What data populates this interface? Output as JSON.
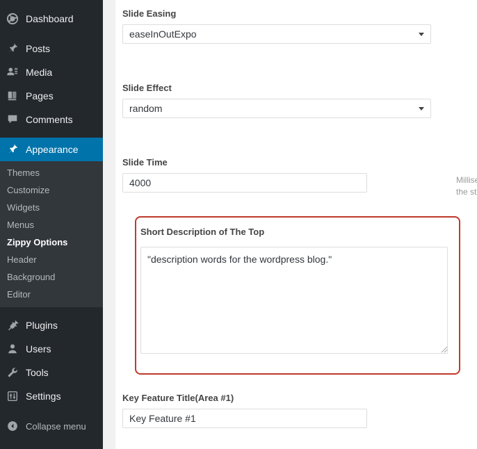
{
  "sidebar": {
    "top_items": [
      {
        "label": "Dashboard",
        "icon": "dashboard-icon",
        "current": false
      },
      {
        "label": "Posts",
        "icon": "pushpin-icon",
        "current": false
      },
      {
        "label": "Media",
        "icon": "media-icon",
        "current": false
      },
      {
        "label": "Pages",
        "icon": "pages-icon",
        "current": false
      },
      {
        "label": "Comments",
        "icon": "comments-icon",
        "current": false
      },
      {
        "label": "Appearance",
        "icon": "appearance-brush-icon",
        "current": true
      }
    ],
    "submenu": [
      {
        "label": "Themes",
        "current": false
      },
      {
        "label": "Customize",
        "current": false
      },
      {
        "label": "Widgets",
        "current": false
      },
      {
        "label": "Menus",
        "current": false
      },
      {
        "label": "Zippy Options",
        "current": true
      },
      {
        "label": "Header",
        "current": false
      },
      {
        "label": "Background",
        "current": false
      },
      {
        "label": "Editor",
        "current": false
      }
    ],
    "bottom_items": [
      {
        "label": "Plugins",
        "icon": "plugin-icon"
      },
      {
        "label": "Users",
        "icon": "user-icon"
      },
      {
        "label": "Tools",
        "icon": "wrench-icon"
      },
      {
        "label": "Settings",
        "icon": "settings-sliders-icon"
      }
    ],
    "collapse": {
      "label": "Collapse menu",
      "icon": "collapse-arrow-icon"
    },
    "colors": {
      "background": "#23282d",
      "submenu_background": "#32373c",
      "highlight": "#0073aa",
      "text": "#eeeeee",
      "muted_text": "#b4b9be"
    }
  },
  "form": {
    "slide_easing": {
      "label": "Slide Easing",
      "value": "easeInOutExpo"
    },
    "slide_effect": {
      "label": "Slide Effect",
      "value": "random"
    },
    "slide_time": {
      "label": "Slide Time",
      "value": "4000",
      "help_line1": "Milliseco",
      "help_line2": "the start"
    },
    "short_description": {
      "label": "Short Description of The Top",
      "value": "\"description words for the wordpress blog.\"",
      "highlight_color": "#c0392b"
    },
    "key_feature_title": {
      "label": "Key Feature Title(Area #1)",
      "value": "Key Feature #1"
    }
  }
}
